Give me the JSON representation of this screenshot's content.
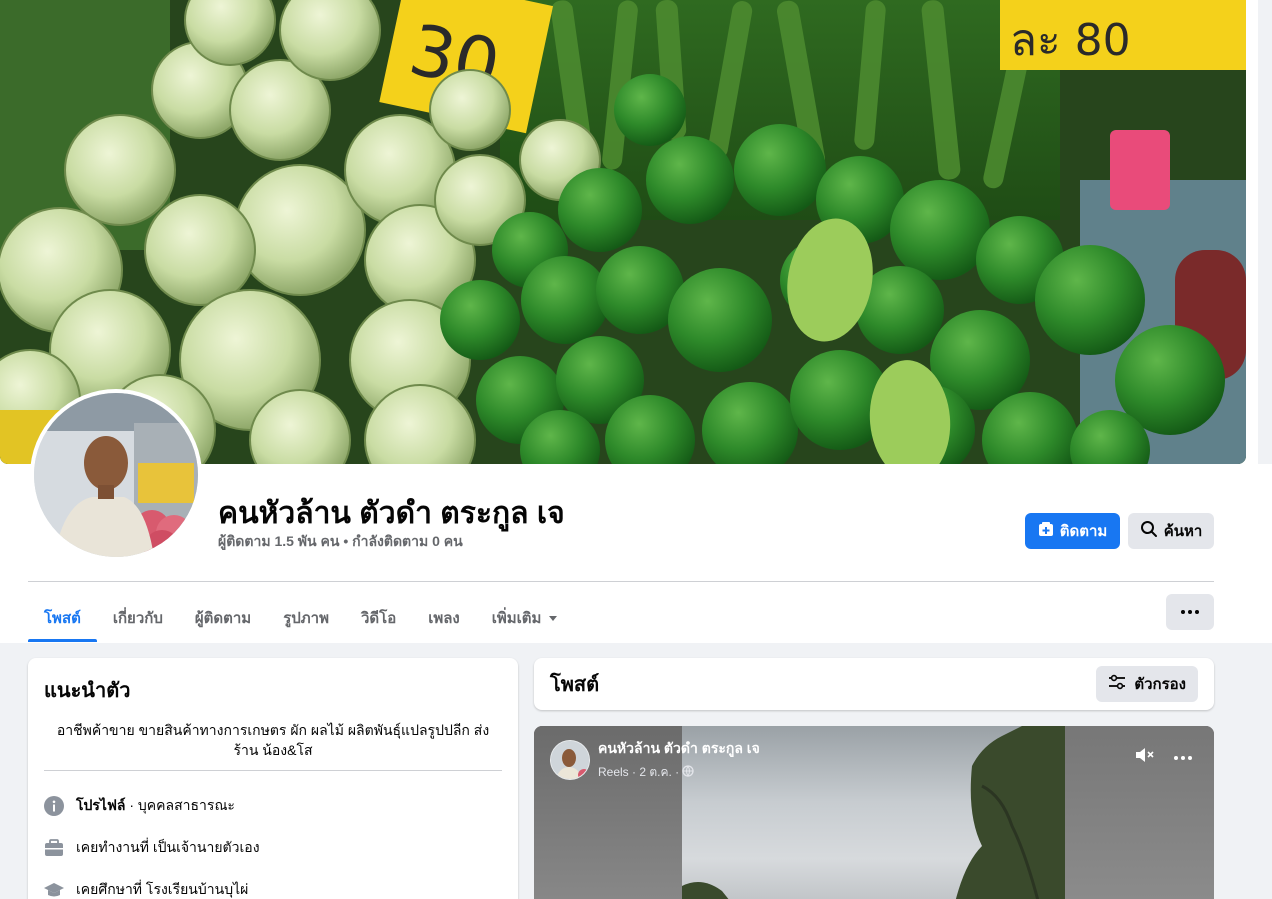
{
  "profile": {
    "name": "คนหัวล้าน ตัวดำ ตระกูล เจ",
    "stats": "ผู้ติดตาม 1.5 พัน คน • กำลังติดตาม 0 คน"
  },
  "actions": {
    "follow_label": "ติดตาม",
    "search_label": "ค้นหา"
  },
  "tabs": [
    {
      "label": "โพสต์",
      "active": true
    },
    {
      "label": "เกี่ยวกับ"
    },
    {
      "label": "ผู้ติดตาม"
    },
    {
      "label": "รูปภาพ"
    },
    {
      "label": "วิดีโอ"
    },
    {
      "label": "เพลง"
    },
    {
      "label": "เพิ่มเติม"
    }
  ],
  "intro": {
    "title": "แนะนำตัว",
    "bio": "อาชีพค้าขาย ขายสินค้าทางการเกษตร ผัก ผลไม้ ผลิตพันธุ์แปลรูปปลีก ส่ง ร้าน น้อง&โส",
    "profile_label": "โปรไฟล์",
    "profile_type": " · บุคคลสาธารณะ",
    "work": "เคยทำงานที่ เป็นเจ้านายตัวเอง",
    "education": "เคยศึกษาที่ โรงเรียนบ้านบุไผ่"
  },
  "posts": {
    "title": "โพสต์",
    "filter_label": "ตัวกรอง"
  },
  "reel": {
    "author": "คนหัวล้าน ตัวดำ ตระกูล เจ",
    "meta": "Reels · 2 ต.ค. ·"
  },
  "cover_price_tags": [
    "30",
    "ละ 80"
  ],
  "colors": {
    "accent": "#1877f2",
    "secondary_button": "#e4e6eb",
    "background": "#f0f2f5",
    "muted_text": "#65676b"
  },
  "icons": [
    "follow-plus-icon",
    "search-icon",
    "more-dots-icon",
    "info-icon",
    "briefcase-icon",
    "graduation-cap-icon",
    "filter-sliders-icon",
    "mute-icon",
    "globe-icon"
  ]
}
